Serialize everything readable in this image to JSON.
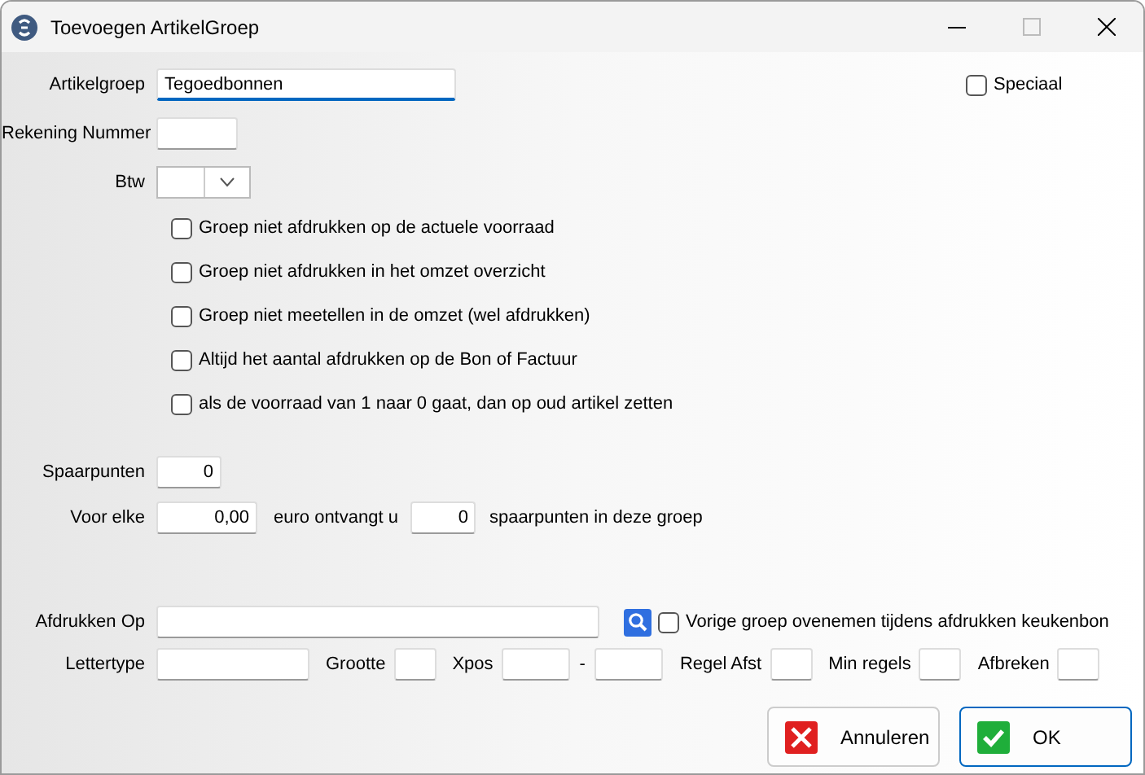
{
  "window": {
    "title": "Toevoegen ArtikelGroep"
  },
  "artikelgroep": {
    "label": "Artikelgroep",
    "value": "Tegoedbonnen"
  },
  "speciaal": {
    "label": "Speciaal",
    "checked": false
  },
  "rekening": {
    "label": "Rekening Nummer"
  },
  "btw": {
    "label": "Btw"
  },
  "options": [
    {
      "label": "Groep niet afdrukken op de actuele voorraad",
      "checked": false
    },
    {
      "label": "Groep niet afdrukken in het omzet overzicht",
      "checked": false
    },
    {
      "label": "Groep niet meetellen in de omzet (wel afdrukken)",
      "checked": false
    },
    {
      "label": "Altijd het aantal afdrukken op de Bon of Factuur",
      "checked": false
    },
    {
      "label": "als de voorraad van 1 naar 0 gaat, dan op oud artikel zetten",
      "checked": false
    }
  ],
  "spaarpunten": {
    "label": "Spaarpunten",
    "value": "0"
  },
  "voor_elke": {
    "label": "Voor elke",
    "amount": "0,00",
    "middle": "euro ontvangt u",
    "points": "0",
    "suffix": "spaarpunten in deze groep"
  },
  "afdrukken_op": {
    "label": "Afdrukken Op",
    "checkbox_label": "Vorige groep ovenemen tijdens afdrukken keukenbon",
    "checked": false
  },
  "print_fields": [
    {
      "label": "Lettertype",
      "kind": "wide"
    },
    {
      "label": "Grootte",
      "kind": "small"
    },
    {
      "label": "Xpos",
      "kind": "range",
      "separator": "-"
    },
    {
      "label": "Regel Afst",
      "kind": "small"
    },
    {
      "label": "Min regels",
      "kind": "small"
    },
    {
      "label": "Afbreken",
      "kind": "small"
    }
  ],
  "buttons": [
    {
      "label": "Annuleren",
      "kind": "cancel",
      "focused": false
    },
    {
      "label": "OK",
      "kind": "ok",
      "focused": true
    }
  ]
}
